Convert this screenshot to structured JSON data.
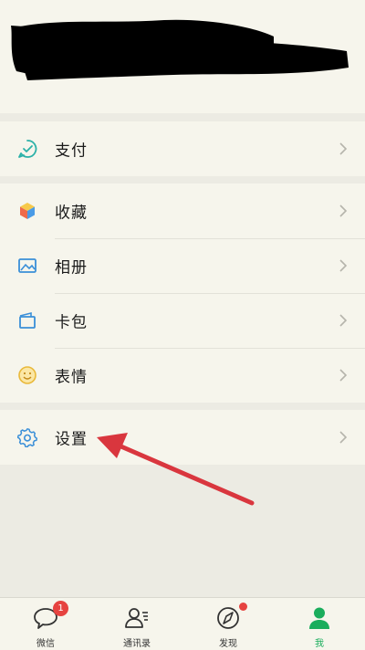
{
  "menu": {
    "pay": {
      "label": "支付",
      "icon": "pay-icon"
    },
    "favorites": {
      "label": "收藏",
      "icon": "cube-icon"
    },
    "album": {
      "label": "相册",
      "icon": "image-icon"
    },
    "cards": {
      "label": "卡包",
      "icon": "wallet-icon"
    },
    "stickers": {
      "label": "表情",
      "icon": "smile-icon"
    },
    "settings": {
      "label": "设置",
      "icon": "gear-icon"
    }
  },
  "tabs": [
    {
      "label": "微信",
      "icon": "chat-icon",
      "badge": "1"
    },
    {
      "label": "通讯录",
      "icon": "contacts-icon"
    },
    {
      "label": "发现",
      "icon": "compass-icon",
      "dot": true
    },
    {
      "label": "我",
      "icon": "person-icon",
      "active": true
    }
  ],
  "colors": {
    "accent": "#1aad5c",
    "badge": "#e64340",
    "annotation_arrow": "#d9363e"
  }
}
